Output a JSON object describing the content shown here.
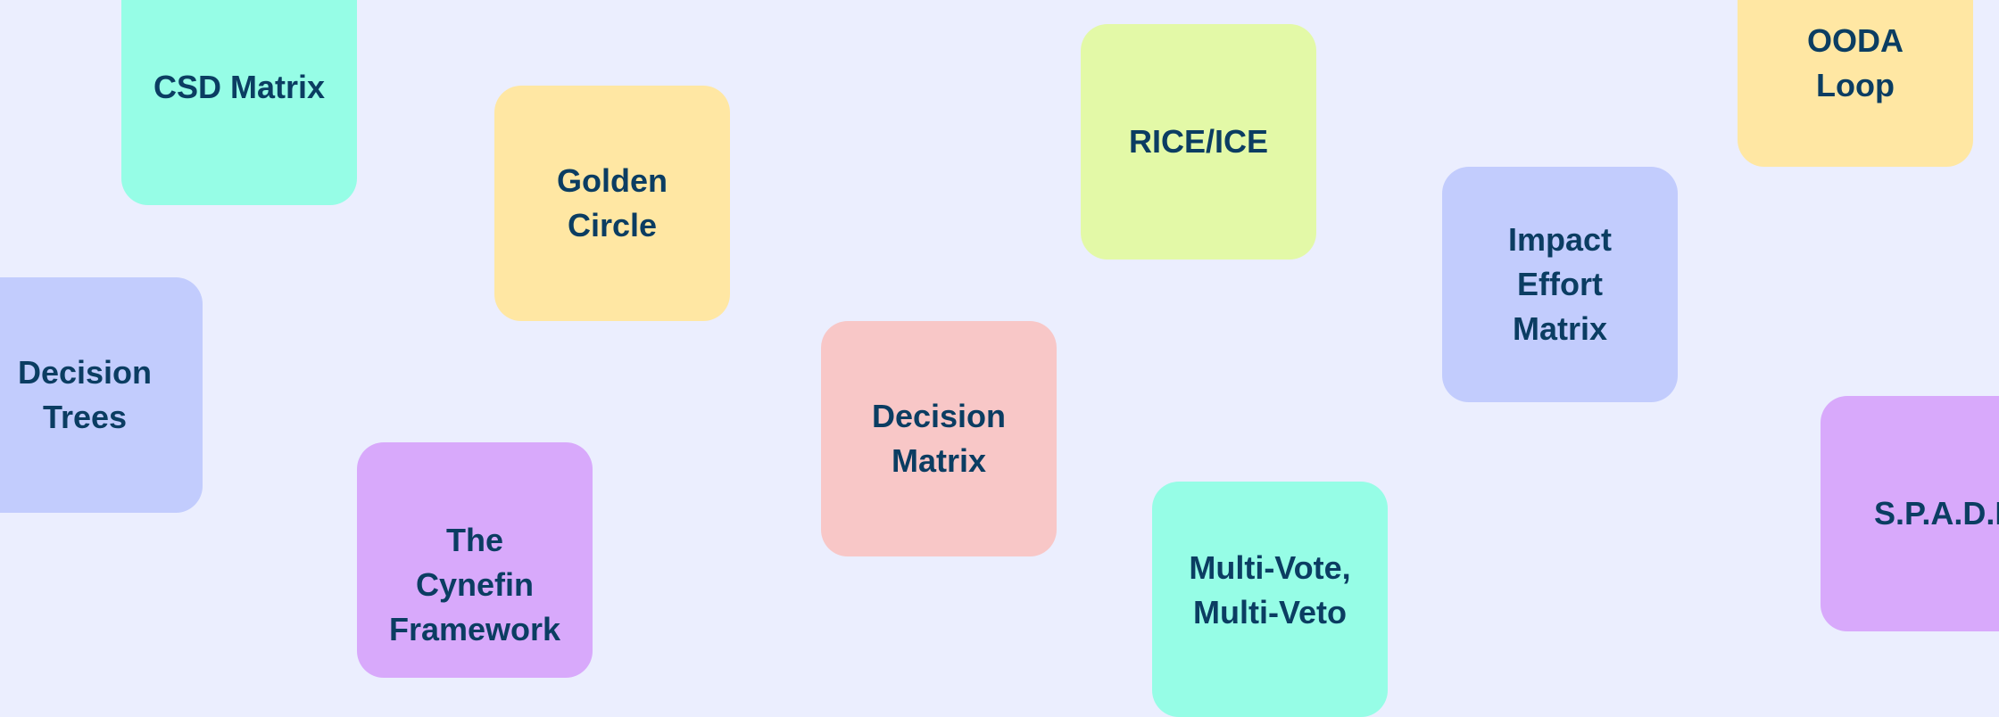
{
  "page": {
    "background_color": "#ebeefe",
    "text_color": "#0b3d62"
  },
  "cards": [
    {
      "id": "csd-matrix",
      "label": "CSD Matrix",
      "color": "#96fde6"
    },
    {
      "id": "golden-circle",
      "label": "Golden\nCircle",
      "color": "#ffe7a3"
    },
    {
      "id": "rice-ice",
      "label": "RICE/ICE",
      "color": "#e3f9a7"
    },
    {
      "id": "ooda-loop",
      "label": "OODA\nLoop",
      "color": "#ffe7a3"
    },
    {
      "id": "impact-effort-matrix",
      "label": "Impact\nEffort\nMatrix",
      "color": "#c2ccfd"
    },
    {
      "id": "decision-trees",
      "label": "Decision\nTrees",
      "color": "#c2ccfd"
    },
    {
      "id": "decision-matrix",
      "label": "Decision\nMatrix",
      "color": "#f8c7c7"
    },
    {
      "id": "cynefin-framework",
      "label": "The\nCynefin\nFramework",
      "color": "#d8a9fb"
    },
    {
      "id": "multi-vote-multi-veto",
      "label": "Multi-Vote,\nMulti-Veto",
      "color": "#96fde6"
    },
    {
      "id": "spade",
      "label": "S.P.A.D.E.",
      "color": "#d8a9fb"
    }
  ]
}
